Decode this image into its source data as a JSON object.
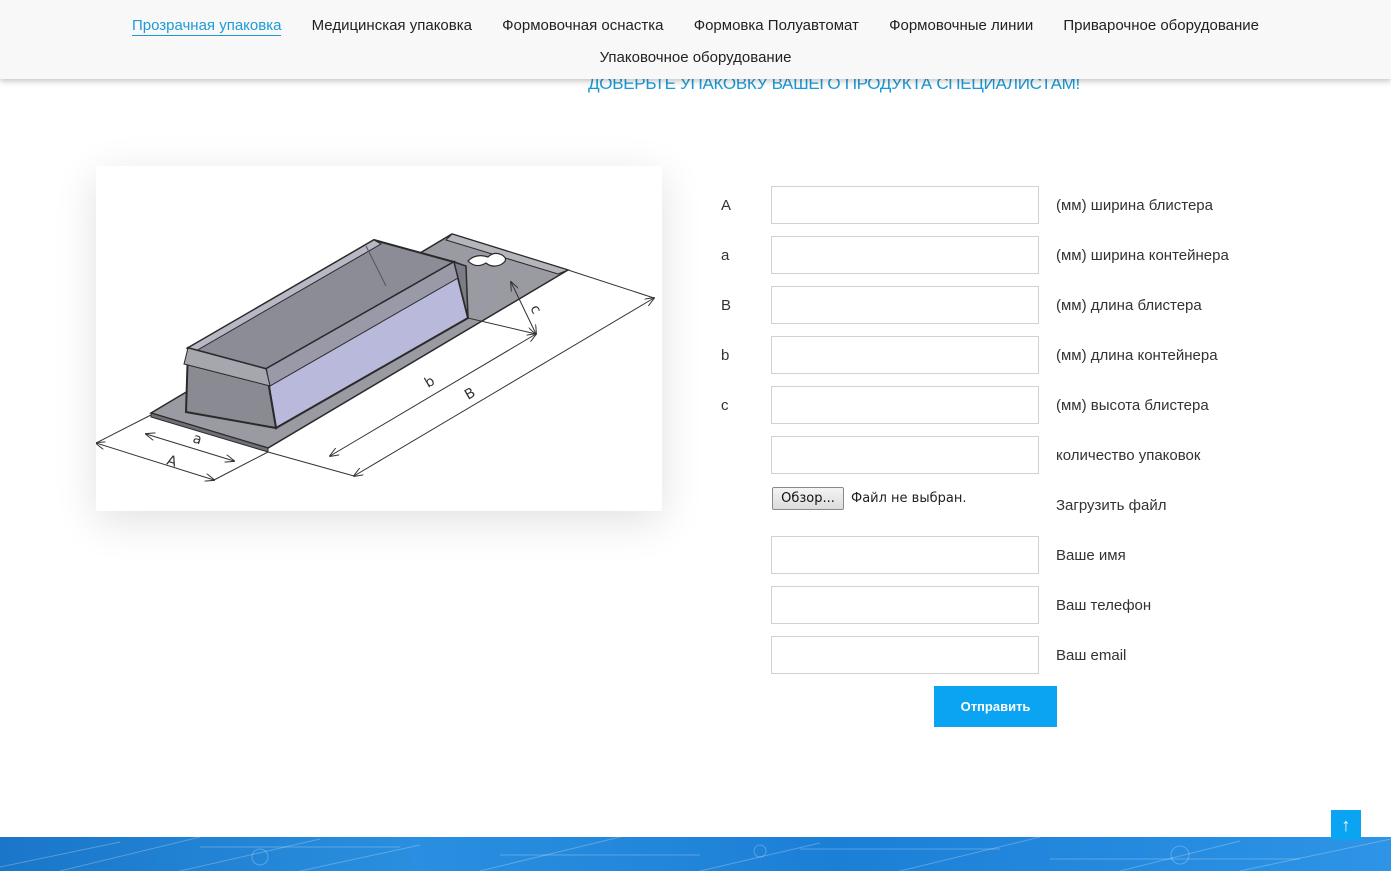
{
  "nav": {
    "row1": [
      "Прозрачная упаковка",
      "Медицинская упаковка",
      "Формовочная оснастка",
      "Формовка Полуавтомат",
      "Формовочные линии",
      "Приварочное оборудование"
    ],
    "row2": [
      "Упаковочное оборудование"
    ],
    "active_index": 0
  },
  "tagline": "ДОВЕРЬТЕ УПАКОВКУ ВАШЕГО ПРОДУКТА СПЕЦИАЛИСТАМ!",
  "diagram": {
    "labels": {
      "A": "A",
      "a": "a",
      "B": "B",
      "b": "b",
      "c": "c"
    }
  },
  "form": {
    "fields": [
      {
        "letter": "A",
        "value": "",
        "label": "(мм) ширина блистера"
      },
      {
        "letter": "a",
        "value": "",
        "label": "(мм) ширина контейнера"
      },
      {
        "letter": "B",
        "value": "",
        "label": "(мм) длина блистера"
      },
      {
        "letter": "b",
        "value": "",
        "label": "(мм) длина контейнера"
      },
      {
        "letter": "c",
        "value": "",
        "label": "(мм) высота блистера"
      },
      {
        "letter": "",
        "value": "",
        "label": "количество упаковок"
      }
    ],
    "file": {
      "button": "Обзор...",
      "status": "Файл не выбран.",
      "label": "Загрузить файл"
    },
    "contact": [
      {
        "value": "",
        "label": "Ваше имя"
      },
      {
        "value": "",
        "label": "Ваш телефон"
      },
      {
        "value": "",
        "label": "Ваш email"
      }
    ],
    "submit": "Отправить"
  },
  "scroll_top_icon": "arrow-up-icon",
  "colors": {
    "accent": "#0aa4f3",
    "active_link": "#1e9bd7",
    "footer": "#1a76c8"
  }
}
